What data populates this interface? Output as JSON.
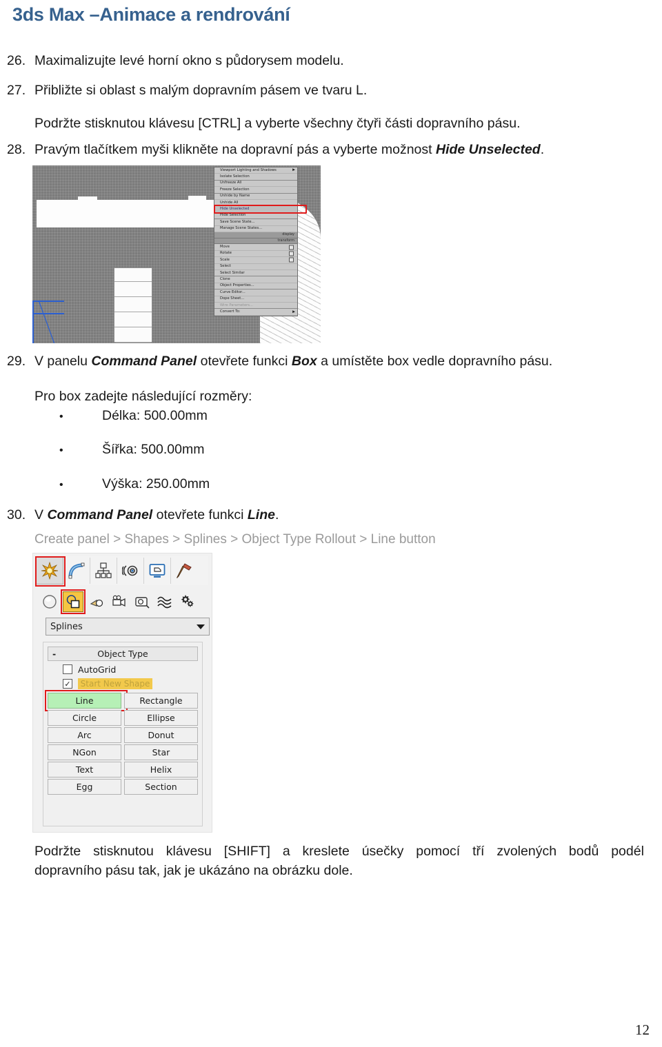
{
  "document": {
    "title": "3ds Max –Animace a rendrování",
    "title_color": "#36618e",
    "page_number": "12"
  },
  "steps": [
    {
      "number": "26.",
      "text": "Maximalizujte levé horní okno s půdorysem modelu."
    },
    {
      "number": "27.",
      "text": "Přibližte si oblast s malým dopravním pásem ve tvaru L."
    },
    {
      "number": "",
      "text": "Podržte stisknutou klávesu [CTRL] a vyberte všechny čtyři části dopravního pásu."
    },
    {
      "number": "28.",
      "text_before": "Pravým tlačítkem myši klikněte na dopravní pás a vyberte možnost ",
      "emphasis": "Hide Unselected",
      "text_after": "."
    },
    {
      "number": "29.",
      "text_a": "V panelu ",
      "emphasis_1": "Command Panel",
      "text_b": " otevřete funkci ",
      "emphasis_2": "Box",
      "text_c": " a umístěte box vedle dopravního pásu."
    },
    {
      "number": "",
      "text": "Pro box zadejte následující rozměry:"
    },
    {
      "number": "30.",
      "text_a": "V ",
      "emphasis_1": "Command Panel",
      "text_b": " otevřete funkci ",
      "emphasis_2": "Line",
      "text_c": "."
    }
  ],
  "box_dimensions": [
    {
      "bullet": "•",
      "label": "Délka: 500.00mm"
    },
    {
      "bullet": "•",
      "label": "Šířka: 500.00mm"
    },
    {
      "bullet": "•",
      "label": "Výška: 250.00mm"
    }
  ],
  "breadcrumb": {
    "text": "Create panel > Shapes > Splines > Object Type Rollout > Line button",
    "color": "#9a9a9a"
  },
  "closing_paragraph": {
    "line1_words": [
      "Podržte",
      "stisknutou",
      "klávesu",
      "[SHIFT]",
      "a",
      "kreslete",
      "úsečky",
      "pomocí",
      "tří",
      "zvolených",
      "bodů",
      "podél"
    ],
    "line2": "dopravního pásu tak, jak je ukázáno na obrázku dole."
  },
  "figure_viewport": {
    "caption": "3ds Max viewport with right-click quad menu",
    "background_color": "#7c7c7c",
    "quad_menu": {
      "items": [
        {
          "label": "Viewport Lighting and Shadows",
          "submenu": true
        },
        {
          "label": "Isolate Selection"
        },
        {
          "label": "Unfreeze All"
        },
        {
          "label": "Freeze Selection"
        },
        {
          "label": "Unhide by Name"
        },
        {
          "label": "Unhide All"
        },
        {
          "label": "Hide Unselected",
          "highlighted": true
        },
        {
          "label": "Hide Selection"
        },
        {
          "label": "Save Scene State..."
        },
        {
          "label": "Manage Scene States..."
        }
      ],
      "display_label": "display",
      "transform_label": "transform",
      "transform_items": [
        {
          "label": "Move",
          "checkbox": true
        },
        {
          "label": "Rotate",
          "checkbox": true
        },
        {
          "label": "Scale",
          "checkbox": true
        },
        {
          "label": "Select"
        },
        {
          "label": "Select Similar"
        },
        {
          "label": "Clone"
        },
        {
          "label": "Object Properties..."
        },
        {
          "label": "Curve Editor..."
        },
        {
          "label": "Dope Sheet..."
        },
        {
          "label": "Wire Parameters...",
          "disabled": true
        },
        {
          "label": "Convert To:",
          "submenu": true
        }
      ]
    },
    "highlight_color": "#e01b1b"
  },
  "figure_command_panel": {
    "caption": "Command Panel – Create > Shapes > Splines",
    "category_tabs": [
      {
        "name": "create-tab",
        "icon": "star-burst-icon",
        "active": true
      },
      {
        "name": "modify-tab",
        "icon": "curve-bend-icon",
        "active": false
      },
      {
        "name": "hierarchy-tab",
        "icon": "hierarchy-tree-icon",
        "active": false
      },
      {
        "name": "motion-tab",
        "icon": "motion-rings-icon",
        "active": false
      },
      {
        "name": "display-tab",
        "icon": "monitor-icon",
        "active": false
      },
      {
        "name": "utilities-tab",
        "icon": "hammer-icon",
        "active": false
      }
    ],
    "subcategory_tabs": [
      {
        "name": "geometry-button",
        "icon": "sphere-icon",
        "active": false
      },
      {
        "name": "shapes-button",
        "icon": "shapes-overlap-icon",
        "active": true
      },
      {
        "name": "lights-button",
        "icon": "light-bulb-icon",
        "active": false
      },
      {
        "name": "cameras-button",
        "icon": "camera-icon",
        "active": false
      },
      {
        "name": "helpers-button",
        "icon": "tape-measure-icon",
        "active": false
      },
      {
        "name": "space-warps-button",
        "icon": "waves-icon",
        "active": false
      },
      {
        "name": "systems-button",
        "icon": "gears-icon",
        "active": false
      }
    ],
    "category_select": {
      "value": "Splines",
      "caret_icon": "chevron-down-icon"
    },
    "object_type_rollout": {
      "header": "Object Type",
      "collapse_icon": "-",
      "autogrid": {
        "label": "AutoGrid",
        "checked": false
      },
      "start_new_shape": {
        "label": "Start New Shape",
        "checked": true
      },
      "buttons": [
        {
          "label": "Line",
          "selected": true
        },
        {
          "label": "Rectangle",
          "selected": false
        },
        {
          "label": "Circle",
          "selected": false
        },
        {
          "label": "Ellipse",
          "selected": false
        },
        {
          "label": "Arc",
          "selected": false
        },
        {
          "label": "Donut",
          "selected": false
        },
        {
          "label": "NGon",
          "selected": false
        },
        {
          "label": "Star",
          "selected": false
        },
        {
          "label": "Text",
          "selected": false
        },
        {
          "label": "Helix",
          "selected": false
        },
        {
          "label": "Egg",
          "selected": false
        },
        {
          "label": "Section",
          "selected": false
        }
      ]
    },
    "highlight_color": "#e01b1b",
    "selected_button_color": "#b6f0b6",
    "active_sub_color": "#f5c542"
  }
}
